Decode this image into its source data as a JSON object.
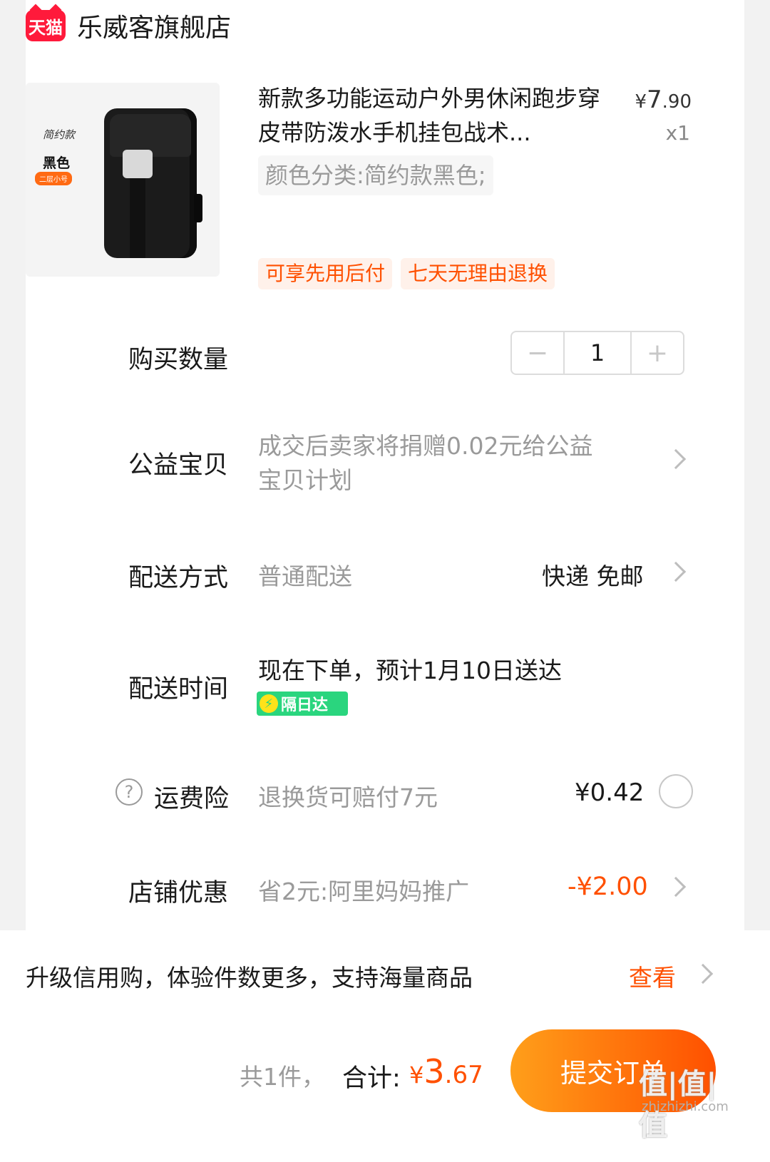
{
  "store": {
    "badge": "天猫",
    "name": "乐威客旗舰店"
  },
  "product": {
    "image_label_style": "简约款",
    "image_label_color": "黑色",
    "image_label_size": "二层小号",
    "title": "新款多功能运动户外男休闲跑步穿皮带防泼水手机挂包战术...",
    "price_symbol": "¥",
    "price_int": "7",
    "price_cents": ".90",
    "quantity": "x1",
    "spec": "颜色分类:简约款黑色;",
    "tags": [
      "可享先用后付",
      "七天无理由退换"
    ]
  },
  "quantity_row": {
    "label": "购买数量",
    "minus": "−",
    "value": "1",
    "plus": "+"
  },
  "charity_row": {
    "label": "公益宝贝",
    "value_line1": "成交后卖家将捐赠0.02元给公益",
    "value_line2": "宝贝计划"
  },
  "shipping_row": {
    "label": "配送方式",
    "method": "普通配送",
    "fee": "快递 免邮"
  },
  "delivery_time_row": {
    "label": "配送时间",
    "value": "现在下单，预计1月10日送达",
    "badge": "隔日达",
    "badge_icon": "lightning-icon"
  },
  "insurance_row": {
    "help_icon": "?",
    "label": "运费险",
    "value": "退换货可赔付7元",
    "price": "¥0.42"
  },
  "discount_row": {
    "label": "店铺优惠",
    "value": "省2元:阿里妈妈推广",
    "amount": "-¥2.00"
  },
  "credit_bar": {
    "text": "升级信用购，体验件数更多，支持海量商品",
    "link": "查看"
  },
  "bottom_bar": {
    "count": "共1件，",
    "total_label": "合计:",
    "total_symbol": "¥",
    "total_int": "3",
    "total_cents": ".67",
    "submit": "提交订单"
  },
  "watermark": {
    "main": "值|值|值",
    "sub": "zhizhizhi.com"
  },
  "colors": {
    "accent": "#ff5000",
    "tmall": "#ff1a3b",
    "nextday": "#2ad57e"
  }
}
